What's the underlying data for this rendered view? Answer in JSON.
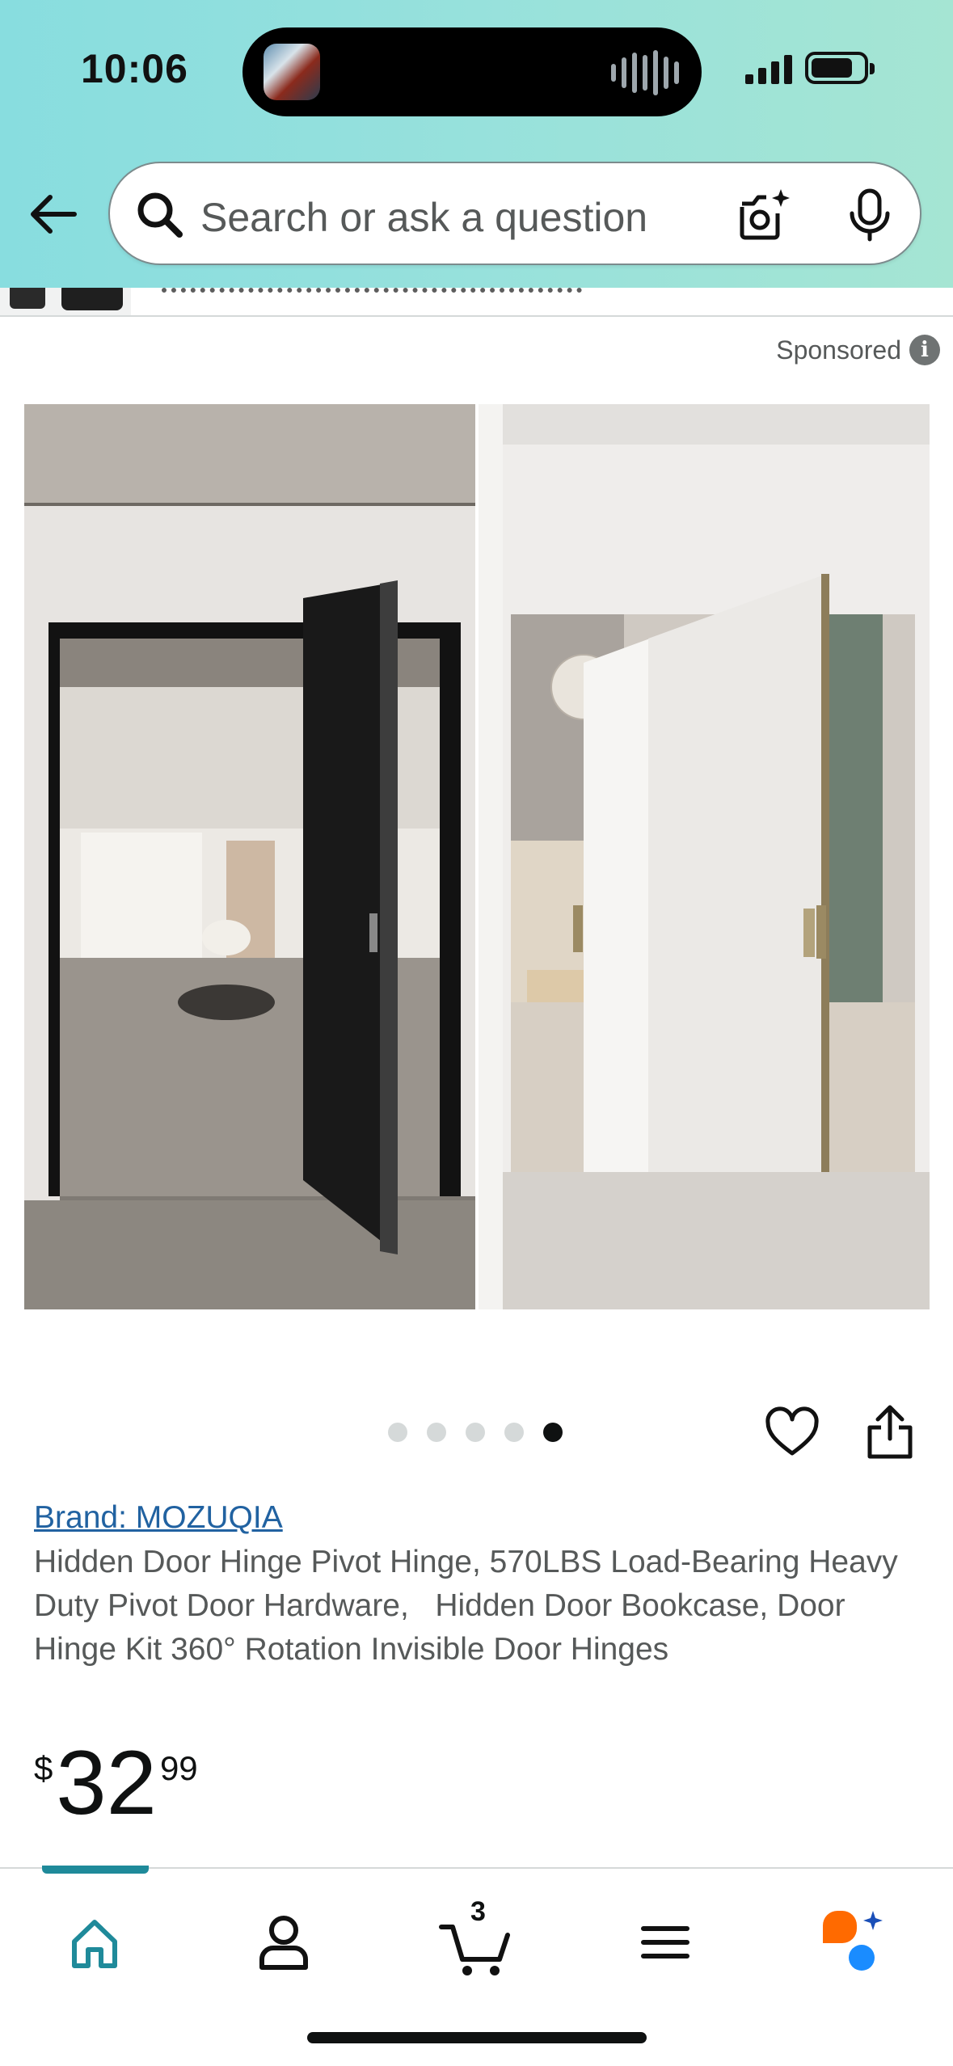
{
  "status_bar": {
    "time": "10:06"
  },
  "search": {
    "placeholder": "Search or ask a question"
  },
  "sponsored": {
    "label": "Sponsored"
  },
  "carousel": {
    "total": 5,
    "active_index": 4
  },
  "product": {
    "brand": "Brand: MOZUQIA",
    "title": "Hidden Door Hinge Pivot Hinge, 570LBS Load-Bearing Heavy Duty Pivot Door Hardware,   Hidden Door Bookcase, Door Hinge Kit 360° Rotation Invisible Door Hinges",
    "price": {
      "symbol": "$",
      "whole": "32",
      "fraction": "99"
    }
  },
  "bottom_nav": {
    "active": "home",
    "cart_count": "3",
    "items": [
      "home-icon",
      "account-icon",
      "cart-icon",
      "menu-icon",
      "rufus-icon"
    ]
  },
  "colors": {
    "header_gradient_start": "#88dddf",
    "header_gradient_end": "#a5e5d3",
    "link": "#2162a1",
    "active_nav": "#1f8a9a",
    "rufus_orange": "#ff6a00",
    "rufus_blue": "#1a8cff"
  }
}
